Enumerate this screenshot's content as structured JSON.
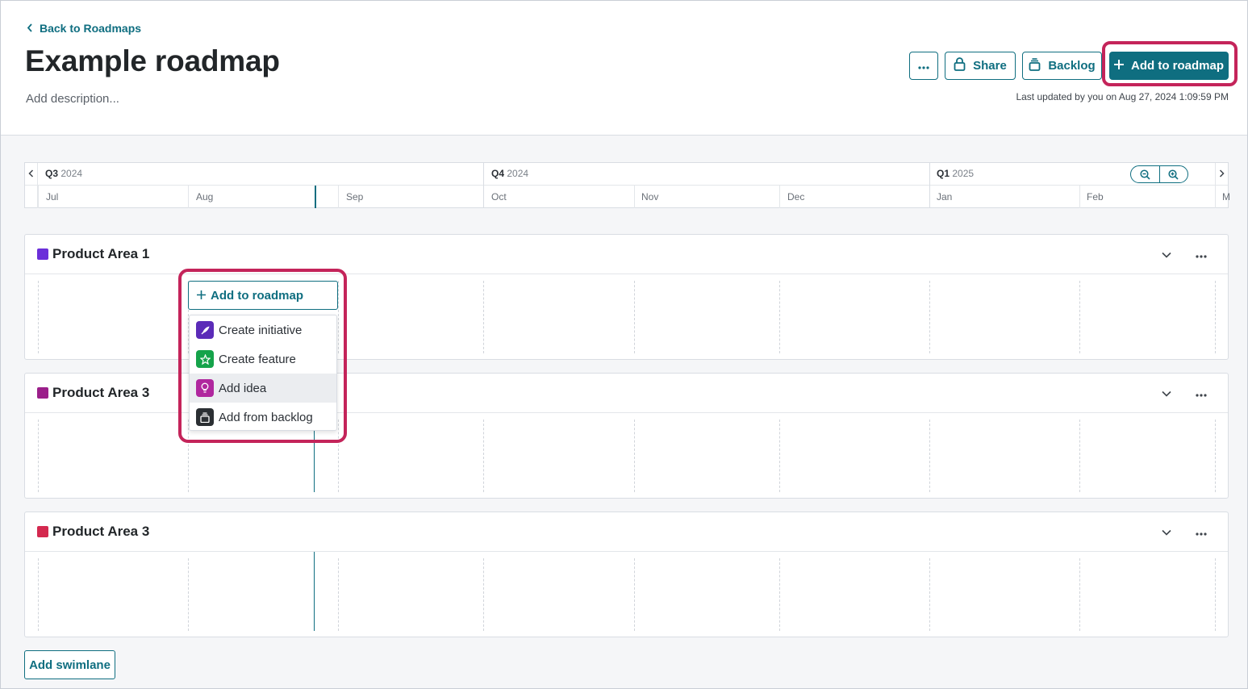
{
  "header": {
    "back_label": "Back to Roadmaps",
    "title": "Example roadmap",
    "description_placeholder": "Add description...",
    "last_updated": "Last updated by you on Aug 27, 2024 1:09:59 PM",
    "share_label": "Share",
    "backlog_label": "Backlog",
    "add_to_roadmap_label": "Add to roadmap"
  },
  "timeline": {
    "quarters": [
      {
        "q": "Q3",
        "year": "2024"
      },
      {
        "q": "Q4",
        "year": "2024"
      },
      {
        "q": "Q1",
        "year": "2025"
      }
    ],
    "months": [
      "Jul",
      "Aug",
      "Sep",
      "Oct",
      "Nov",
      "Dec",
      "Jan",
      "Feb",
      "M"
    ]
  },
  "lanes": [
    {
      "title": "Product Area 1",
      "color": "#6b2fd9"
    },
    {
      "title": "Product Area 3",
      "color": "#9b1f8a"
    },
    {
      "title": "Product Area 3",
      "color": "#d4294f"
    }
  ],
  "dropdown": {
    "button_label": "Add to roadmap",
    "items": [
      {
        "label": "Create initiative",
        "icon": "rocket-icon",
        "color": "#5b2bb8"
      },
      {
        "label": "Create feature",
        "icon": "star-icon",
        "color": "#15a34a"
      },
      {
        "label": "Add idea",
        "icon": "lightbulb-icon",
        "color": "#b0279e"
      },
      {
        "label": "Add from backlog",
        "icon": "backlog-icon",
        "color": "#2b2f33"
      }
    ]
  },
  "footer": {
    "add_swimlane_label": "Add swimlane"
  },
  "colors": {
    "accent": "#0f6e80",
    "highlight": "#c4245a"
  }
}
